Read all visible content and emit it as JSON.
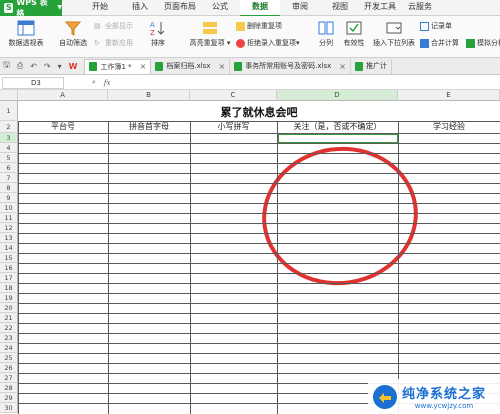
{
  "app": {
    "name": "WPS 表格"
  },
  "menu": [
    "开始",
    "插入",
    "页面布局",
    "公式",
    "数据",
    "审阅",
    "视图",
    "开发工具",
    "云服务"
  ],
  "menu_active_index": 4,
  "ribbon": {
    "pivot": "数据透视表",
    "autofilter": "自动筛选",
    "show_all": "全部显示",
    "reapply": "重新应用",
    "sort": "排序",
    "highlight_dup": "高亮重复项",
    "remove_dup": "删除重复项",
    "reject_dup": "拒绝录入重复项",
    "split": "分列",
    "validity": "有效性",
    "insert_dropdown": "插入下拉列表",
    "record_sheet": "记录单",
    "consolidate": "合并计算",
    "simulate": "模拟分析"
  },
  "tabs": [
    {
      "label": "工作簿1 *"
    },
    {
      "label": "档案归档.xlsx"
    },
    {
      "label": "事务所常用账号及密码.xlsx"
    },
    {
      "label": "推广计"
    }
  ],
  "formula_bar": {
    "cell_ref": "D3",
    "fx": "fx",
    "value": ""
  },
  "columns": [
    "A",
    "B",
    "C",
    "D",
    "E"
  ],
  "selected_column_index": 3,
  "rows": [
    "1",
    "2",
    "3",
    "4",
    "5",
    "6",
    "7",
    "8",
    "9",
    "10",
    "11",
    "12",
    "13",
    "14",
    "15",
    "16",
    "17",
    "18",
    "19",
    "20",
    "21",
    "22",
    "23",
    "24",
    "25",
    "26",
    "27",
    "28",
    "29",
    "30"
  ],
  "selected_row": "3",
  "sheet": {
    "title": "累了就休息会吧",
    "headers": [
      "平台号",
      "拼音首字母",
      "小写拼写",
      "关注（是，否或不确定）",
      "学习经验"
    ]
  },
  "watermark": {
    "title": "纯净系统之家",
    "url": "www.ycwjzy.com"
  },
  "colors": {
    "accent": "#27a13a",
    "annotation": "#e0322f"
  }
}
